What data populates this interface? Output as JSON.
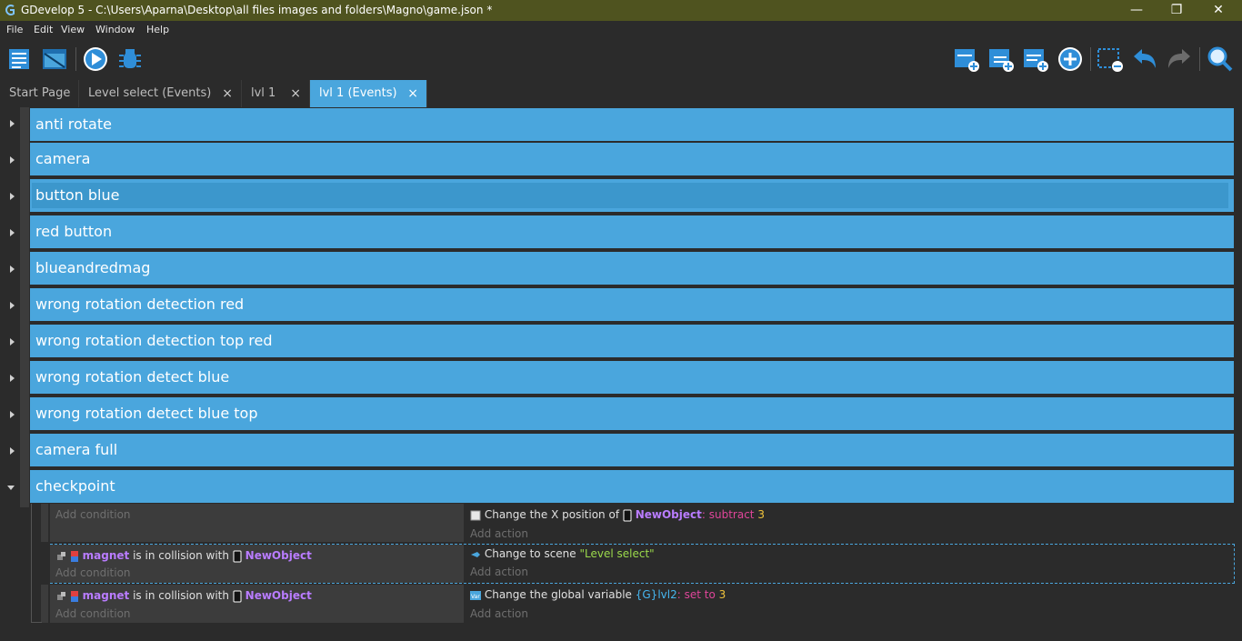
{
  "window": {
    "title": "GDevelop 5 - C:\\Users\\Aparna\\Desktop\\all files images and folders\\Magno\\game.json *",
    "controls": [
      "minimize-icon",
      "restore-icon",
      "close-icon"
    ]
  },
  "menu": {
    "file": "File",
    "edit": "Edit",
    "view": "View",
    "window": "Window",
    "help": "Help"
  },
  "toolbar": {
    "left": [
      "project-manager-icon",
      "scene-icon",
      "preview-play-icon",
      "debugger-icon"
    ],
    "right": [
      "add-event-icon",
      "add-subevent-icon",
      "add-other-event-icon",
      "add-instruction-icon",
      "delete-selected-icon",
      "undo-icon",
      "redo-icon",
      "search-icon"
    ]
  },
  "tabs": [
    {
      "label": "Start Page",
      "closable": false,
      "active": false
    },
    {
      "label": "Level select (Events)",
      "closable": true,
      "active": false
    },
    {
      "label": "lvl 1",
      "closable": true,
      "active": false
    },
    {
      "label": "lvl 1 (Events)",
      "closable": true,
      "active": true
    }
  ],
  "tab_close_glyph": "×",
  "groups": [
    {
      "label": "anti rotate",
      "collapsed": true
    },
    {
      "label": "camera",
      "collapsed": true
    },
    {
      "label": "button blue",
      "collapsed": true,
      "selected": true
    },
    {
      "label": "red button",
      "collapsed": true
    },
    {
      "label": "blueandredmag",
      "collapsed": true
    },
    {
      "label": "wrong rotation detection red",
      "collapsed": true
    },
    {
      "label": "wrong rotation detection top red",
      "collapsed": true
    },
    {
      "label": "wrong rotation detect blue",
      "collapsed": true
    },
    {
      "label": "wrong rotation detect blue top",
      "collapsed": true
    },
    {
      "label": "camera full",
      "collapsed": true
    },
    {
      "label": "checkpoint",
      "collapsed": false
    }
  ],
  "events": [
    {
      "condition": null,
      "condition_placeholder": "Add condition",
      "action": {
        "text": "Change the X position of",
        "object": "NewObject",
        "op": ": subtract",
        "value": "3"
      },
      "action_placeholder": "Add action"
    },
    {
      "condition": {
        "object": "magnet",
        "text": "is in collision with",
        "target": "NewObject"
      },
      "condition_placeholder": "Add condition",
      "action": {
        "text": "Change to scene",
        "value": "\"Level select\""
      },
      "action_placeholder": "Add action"
    },
    {
      "condition": {
        "object": "magnet",
        "text": "is in collision with",
        "target": "NewObject"
      },
      "condition_placeholder": "Add condition",
      "action": {
        "text": "Change the global variable",
        "var_prefix": "{G}",
        "variable": "lvl2",
        "op": ": set to",
        "value": "3"
      },
      "action_placeholder": "Add action"
    }
  ],
  "colors": {
    "accent": "#4aa6dd",
    "titlebar": "#4f531f",
    "background": "#2b2b2b",
    "object": "#b97cff",
    "operator": "#e0459a",
    "number": "#f0c33c",
    "string": "#9bd94b"
  }
}
